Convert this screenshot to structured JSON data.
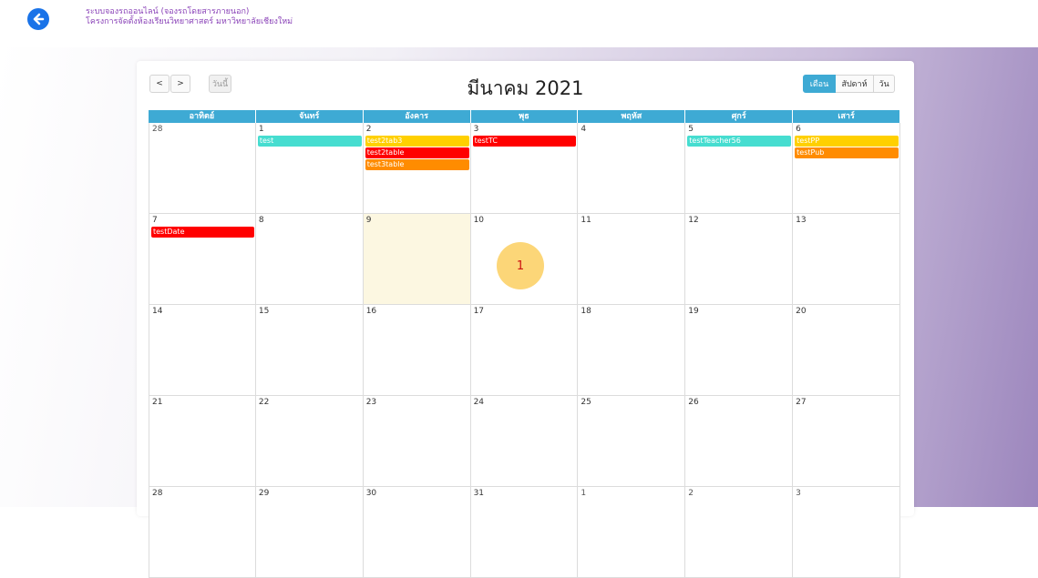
{
  "header": {
    "line1": "ระบบจองรถออนไลน์ (จองรถโดยสารภายนอก)",
    "line2": "โครงการจัดตั้งห้องเรียนวิทยาศาสตร์ มหาวิทยาลัยเชียงใหม่",
    "back_icon": "arrow-left-icon",
    "back_color": "#1a73e8"
  },
  "toolbar": {
    "prev_label": "<",
    "next_label": ">",
    "today_label": "วันนี้",
    "title": "มีนาคม 2021",
    "views": [
      {
        "label": "เดือน",
        "active": true
      },
      {
        "label": "สัปดาห์",
        "active": false
      },
      {
        "label": "วัน",
        "active": false
      }
    ]
  },
  "calendar": {
    "weekdays": [
      "อาทิตย์",
      "จันทร์",
      "อังคาร",
      "พุธ",
      "พฤหัส",
      "ศุกร์",
      "เสาร์"
    ],
    "weeks": [
      [
        {
          "day": "28",
          "other": true,
          "events": []
        },
        {
          "day": "1",
          "events": [
            {
              "title": "test",
              "color": "#46ddd0"
            }
          ]
        },
        {
          "day": "2",
          "events": [
            {
              "title": "test2tab3",
              "color": "#ffd000"
            },
            {
              "title": "test2table",
              "color": "#ff0000"
            },
            {
              "title": "test3table",
              "color": "#ff8c00"
            }
          ]
        },
        {
          "day": "3",
          "events": [
            {
              "title": "testTC",
              "color": "#ff0000"
            }
          ]
        },
        {
          "day": "4",
          "events": []
        },
        {
          "day": "5",
          "events": [
            {
              "title": "testTeacher56",
              "color": "#46ddd0"
            }
          ]
        },
        {
          "day": "6",
          "events": [
            {
              "title": "testPP",
              "color": "#ffd000"
            },
            {
              "title": "testPub",
              "color": "#ff8c00"
            }
          ]
        }
      ],
      [
        {
          "day": "7",
          "events": [
            {
              "title": "testDate",
              "color": "#ff0000"
            }
          ]
        },
        {
          "day": "8",
          "events": []
        },
        {
          "day": "9",
          "today": true,
          "events": []
        },
        {
          "day": "10",
          "events": []
        },
        {
          "day": "11",
          "events": []
        },
        {
          "day": "12",
          "events": []
        },
        {
          "day": "13",
          "events": []
        }
      ],
      [
        {
          "day": "14",
          "events": []
        },
        {
          "day": "15",
          "events": []
        },
        {
          "day": "16",
          "events": []
        },
        {
          "day": "17",
          "events": []
        },
        {
          "day": "18",
          "events": []
        },
        {
          "day": "19",
          "events": []
        },
        {
          "day": "20",
          "events": []
        }
      ],
      [
        {
          "day": "21",
          "events": []
        },
        {
          "day": "22",
          "events": []
        },
        {
          "day": "23",
          "events": []
        },
        {
          "day": "24",
          "events": []
        },
        {
          "day": "25",
          "events": []
        },
        {
          "day": "26",
          "events": []
        },
        {
          "day": "27",
          "events": []
        }
      ],
      [
        {
          "day": "28",
          "events": []
        },
        {
          "day": "29",
          "events": []
        },
        {
          "day": "30",
          "events": []
        },
        {
          "day": "31",
          "events": []
        },
        {
          "day": "1",
          "other": true,
          "events": []
        },
        {
          "day": "2",
          "other": true,
          "events": []
        },
        {
          "day": "3",
          "other": true,
          "events": []
        }
      ]
    ]
  },
  "marker": {
    "label": "1"
  },
  "colors": {
    "accent": "#3eaad4",
    "today": "#fcf7e1",
    "header_text": "#8a43b8"
  }
}
